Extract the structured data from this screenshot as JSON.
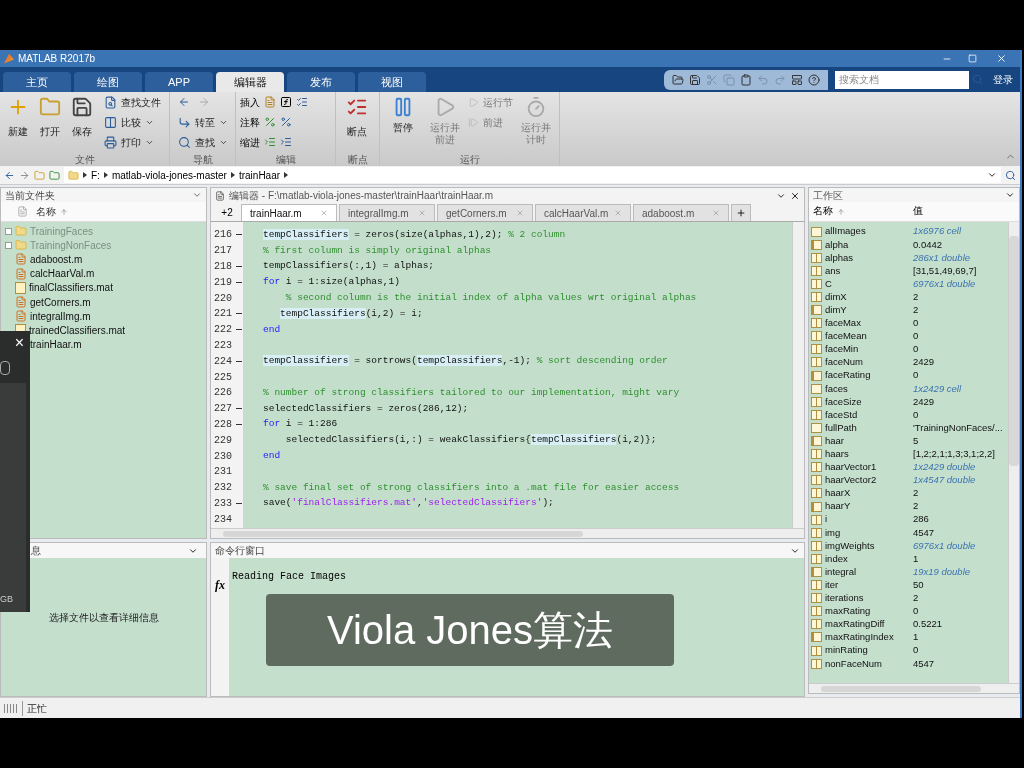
{
  "window": {
    "title": "MATLAB R2017b"
  },
  "tabs": [
    {
      "label": "主页",
      "selected": false
    },
    {
      "label": "绘图",
      "selected": false
    },
    {
      "label": "APP",
      "selected": false
    },
    {
      "label": "编辑器",
      "selected": true
    },
    {
      "label": "发布",
      "selected": false
    },
    {
      "label": "视图",
      "selected": false
    }
  ],
  "search": {
    "placeholder": "搜索文档"
  },
  "login": "登录",
  "ribbon": {
    "file_group": {
      "label": "文件",
      "new": "新建",
      "open": "打开",
      "save": "保存",
      "find_files": "查找文件",
      "compare": "比较",
      "print": "打印"
    },
    "navigate_group": {
      "label": "导航",
      "go_to": "转至",
      "find": "查找"
    },
    "edit_group": {
      "label": "编辑",
      "insert": "插入",
      "comment": "注释",
      "indent": "缩进"
    },
    "breakpoints_group": {
      "label": "断点",
      "breakpoints": "断点"
    },
    "run_group": {
      "label": "运行",
      "items": [
        {
          "kind": "large",
          "label": "暂停",
          "disabled": false
        },
        {
          "kind": "large",
          "label": "运行并前进",
          "disabled": true
        },
        {
          "kind": "small",
          "label": "运行节",
          "disabled": true
        },
        {
          "kind": "small",
          "label": "前进",
          "disabled": true
        },
        {
          "kind": "large",
          "label": "运行并计时",
          "disabled": true
        }
      ]
    }
  },
  "address": [
    "F:",
    "matlab-viola-jones-master",
    "trainHaar"
  ],
  "current_folder": {
    "title": "当前文件夹",
    "column": "名称",
    "items": [
      {
        "kind": "folder",
        "name": "TrainingFaces",
        "icon_shown": true
      },
      {
        "kind": "folder",
        "name": "TrainingNonFaces",
        "icon_shown": true
      },
      {
        "kind": "m",
        "name": "adaboost.m",
        "icon_shown": true
      },
      {
        "kind": "m",
        "name": "calcHaarVal.m",
        "icon_shown": true
      },
      {
        "kind": "mat",
        "name": "finalClassifiers.mat",
        "icon_shown": true
      },
      {
        "kind": "m",
        "name": "getCorners.m",
        "icon_shown": true
      },
      {
        "kind": "m",
        "name": "integralImg.m",
        "icon_shown": true
      },
      {
        "kind": "mat",
        "name": "trainedClassifiers.mat",
        "icon_shown": true
      },
      {
        "kind": "m",
        "name": "trainHaar.m",
        "icon_shown": false
      }
    ]
  },
  "details": {
    "title": "息",
    "message": "选择文件以查看详细信息"
  },
  "editor": {
    "title": "编辑器 - F:\\matlab-viola-jones-master\\trainHaar\\trainHaar.m",
    "sort_label": "+2",
    "tabs": [
      {
        "label": "trainHaar.m",
        "selected": true
      },
      {
        "label": "integralImg.m",
        "selected": false
      },
      {
        "label": "getCorners.m",
        "selected": false
      },
      {
        "label": "calcHaarVal.m",
        "selected": false
      },
      {
        "label": "adaboost.m",
        "selected": false
      }
    ],
    "lines": [
      {
        "number": "216",
        "executable": true,
        "segments": [
          {
            "kind": "var",
            "text": "tempClassifiers"
          },
          {
            "kind": "code",
            "text": " = zeros(size(alphas,1),2); "
          },
          {
            "kind": "comment",
            "text": "% 2 column"
          }
        ]
      },
      {
        "number": "217",
        "executable": false,
        "segments": [
          {
            "kind": "comment",
            "text": "% first column is simply original alphas"
          }
        ]
      },
      {
        "number": "218",
        "executable": true,
        "segments": [
          {
            "kind": "code",
            "text": "tempClassifiers(:,1) = alphas;"
          }
        ]
      },
      {
        "number": "219",
        "executable": true,
        "segments": [
          {
            "kind": "keyword",
            "text": "for"
          },
          {
            "kind": "code",
            "text": " i = 1:size(alphas,1)"
          }
        ]
      },
      {
        "number": "220",
        "executable": false,
        "segments": [
          {
            "kind": "comment",
            "text": "    % second column is the initial index of alpha values wrt original alphas"
          }
        ]
      },
      {
        "number": "221",
        "executable": true,
        "segments": [
          {
            "kind": "var",
            "text": "   tempClassifiers"
          },
          {
            "kind": "code",
            "text": "(i,2) = i;"
          }
        ]
      },
      {
        "number": "222",
        "executable": true,
        "segments": [
          {
            "kind": "keyword",
            "text": "end"
          }
        ]
      },
      {
        "number": "223",
        "executable": false
      },
      {
        "number": "224",
        "executable": true,
        "segments": [
          {
            "kind": "var",
            "text": "tempClassifiers"
          },
          {
            "kind": "code",
            "text": " = sortrows("
          },
          {
            "kind": "var",
            "text": "tempClassifiers"
          },
          {
            "kind": "code",
            "text": ",-1); "
          },
          {
            "kind": "comment",
            "text": "% sort descending order"
          }
        ]
      },
      {
        "number": "225",
        "executable": false
      },
      {
        "number": "226",
        "executable": false,
        "segments": [
          {
            "kind": "comment",
            "text": "% number of strong classifiers tailored to our implementation, might vary"
          }
        ]
      },
      {
        "number": "227",
        "executable": true,
        "segments": [
          {
            "kind": "code",
            "text": "selectedClassifiers = zeros(286,12);"
          }
        ]
      },
      {
        "number": "228",
        "executable": true,
        "segments": [
          {
            "kind": "keyword",
            "text": "for"
          },
          {
            "kind": "code",
            "text": " i = 1:286"
          }
        ]
      },
      {
        "number": "229",
        "executable": false,
        "segments": [
          {
            "kind": "code",
            "text": "    selectedClassifiers(i,:) = weakClassifiers{"
          },
          {
            "kind": "var",
            "text": "tempClassifiers"
          },
          {
            "kind": "code",
            "text": "(i,2)};"
          }
        ]
      },
      {
        "number": "230",
        "executable": false,
        "segments": [
          {
            "kind": "keyword",
            "text": "end"
          }
        ]
      },
      {
        "number": "231",
        "executable": false
      },
      {
        "number": "232",
        "executable": false,
        "segments": [
          {
            "kind": "comment",
            "text": "% save final set of strong classifiers into a .mat file for easier access"
          }
        ]
      },
      {
        "number": "233",
        "executable": true,
        "segments": [
          {
            "kind": "code",
            "text": "save("
          },
          {
            "kind": "string",
            "text": "'finalClassifiers.mat'"
          },
          {
            "kind": "code",
            "text": ","
          },
          {
            "kind": "string",
            "text": "'selectedClassifiers'"
          },
          {
            "kind": "code",
            "text": ");"
          }
        ]
      },
      {
        "number": "234",
        "executable": false
      }
    ]
  },
  "command_window": {
    "title": "命令行窗口",
    "output": "Reading Face Images",
    "prompt": "fx"
  },
  "workspace": {
    "title": "工作区",
    "columns": [
      "名称",
      "值"
    ],
    "rows": [
      {
        "kind": "cell",
        "name": "allImages",
        "value": "1x6976 cell",
        "summary": true
      },
      {
        "kind": "scalar",
        "name": "alpha",
        "value": "0.0442",
        "summary": false
      },
      {
        "kind": "matrix",
        "name": "alphas",
        "value": "286x1 double",
        "summary": true
      },
      {
        "kind": "matrix",
        "name": "ans",
        "value": "[31,51,49,69,7]",
        "summary": false
      },
      {
        "kind": "matrix",
        "name": "C",
        "value": "6976x1 double",
        "summary": true
      },
      {
        "kind": "matrix",
        "name": "dimX",
        "value": "2",
        "summary": false
      },
      {
        "kind": "scalar",
        "name": "dimY",
        "value": "2",
        "summary": false
      },
      {
        "kind": "matrix",
        "name": "faceMax",
        "value": "0",
        "summary": false
      },
      {
        "kind": "matrix",
        "name": "faceMean",
        "value": "0",
        "summary": false
      },
      {
        "kind": "matrix",
        "name": "faceMin",
        "value": "0",
        "summary": false
      },
      {
        "kind": "matrix",
        "name": "faceNum",
        "value": "2429",
        "summary": false
      },
      {
        "kind": "scalar",
        "name": "faceRating",
        "value": "0",
        "summary": false
      },
      {
        "kind": "cell",
        "name": "faces",
        "value": "1x2429 cell",
        "summary": true
      },
      {
        "kind": "matrix",
        "name": "faceSize",
        "value": "2429",
        "summary": false
      },
      {
        "kind": "matrix",
        "name": "faceStd",
        "value": "0",
        "summary": false
      },
      {
        "kind": "char",
        "name": "fullPath",
        "value": "'TrainingNonFaces/...",
        "summary": false
      },
      {
        "kind": "scalar",
        "name": "haar",
        "value": "5",
        "summary": false
      },
      {
        "kind": "matrix",
        "name": "haars",
        "value": "[1,2;2,1;1,3;3,1;2,2]",
        "summary": false
      },
      {
        "kind": "matrix",
        "name": "haarVector1",
        "value": "1x2429 double",
        "summary": true
      },
      {
        "kind": "matrix",
        "name": "haarVector2",
        "value": "1x4547 double",
        "summary": true
      },
      {
        "kind": "matrix",
        "name": "haarX",
        "value": "2",
        "summary": false
      },
      {
        "kind": "scalar",
        "name": "haarY",
        "value": "2",
        "summary": false
      },
      {
        "kind": "matrix",
        "name": "i",
        "value": "286",
        "summary": false
      },
      {
        "kind": "matrix",
        "name": "img",
        "value": "4547",
        "summary": false
      },
      {
        "kind": "matrix",
        "name": "imgWeights",
        "value": "6976x1 double",
        "summary": true
      },
      {
        "kind": "matrix",
        "name": "index",
        "value": "1",
        "summary": false
      },
      {
        "kind": "scalar",
        "name": "integral",
        "value": "19x19 double",
        "summary": true
      },
      {
        "kind": "matrix",
        "name": "iter",
        "value": "50",
        "summary": false
      },
      {
        "kind": "matrix",
        "name": "iterations",
        "value": "2",
        "summary": false
      },
      {
        "kind": "matrix",
        "name": "maxRating",
        "value": "0",
        "summary": false
      },
      {
        "kind": "matrix",
        "name": "maxRatingDiff",
        "value": "0.5221",
        "summary": false
      },
      {
        "kind": "scalar",
        "name": "maxRatingIndex",
        "value": "1",
        "summary": false
      },
      {
        "kind": "matrix",
        "name": "minRating",
        "value": "0",
        "summary": false
      },
      {
        "kind": "matrix",
        "name": "nonFaceNum",
        "value": "4547",
        "summary": false
      }
    ]
  },
  "status_bar": {
    "text": "正忙"
  },
  "recorder_panel": {
    "close": "×",
    "label": "GB"
  },
  "caption": {
    "text": "Viola Jones算法"
  }
}
